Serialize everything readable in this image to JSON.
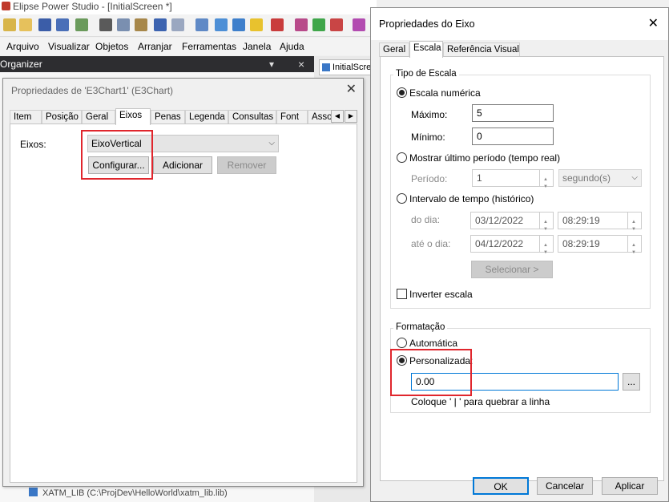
{
  "app": {
    "title": "Elipse Power Studio - [InitialScreen *]"
  },
  "menu": [
    "Arquivo",
    "Visualizar",
    "Objetos",
    "Arranjar",
    "Ferramentas",
    "Janela",
    "Ajuda"
  ],
  "organizer": {
    "title": "Organizer",
    "pin": "▾",
    "close": "×"
  },
  "document_tab": {
    "label": "InitialScreen"
  },
  "tree_bottom_item": "XATM_LIB (C:\\ProjDev\\HelloWorld\\xatm_lib.lib)",
  "chart_dialog": {
    "title": "Propriedades de 'E3Chart1' (E3Chart)",
    "tabs": [
      "Item",
      "Posição",
      "Geral",
      "Eixos",
      "Penas",
      "Legenda",
      "Consultas",
      "Font",
      "Asso"
    ],
    "active_tab": "Eixos",
    "axes_label": "Eixos:",
    "axes_selected": "EixoVertical",
    "configure_button": "Configurar...",
    "add_button": "Adicionar",
    "remove_button": "Remover"
  },
  "axis_dialog": {
    "title": "Propriedades do Eixo",
    "tabs": [
      "Geral",
      "Escala",
      "Referência Visual"
    ],
    "active_tab": "Escala",
    "scale_group_label": "Tipo de Escala",
    "numeric_scale": {
      "label": "Escala numérica",
      "max_label": "Máximo:",
      "max_value": "5",
      "min_label": "Mínimo:",
      "min_value": "0"
    },
    "last_period": {
      "label": "Mostrar último período (tempo real)",
      "period_label": "Período:",
      "period_value": "1",
      "unit": "segundo(s)"
    },
    "interval": {
      "label": "Intervalo de tempo (histórico)",
      "from_label": "do dia:",
      "from_date": "03/12/2022",
      "from_time": "08:29:19",
      "to_label": "até o dia:",
      "to_date": "04/12/2022",
      "to_time": "08:29:19",
      "select_button": "Selecionar >"
    },
    "invert_scale": "Inverter escala",
    "format_group_label": "Formatação",
    "format_auto": "Automática",
    "format_custom": "Personalizada:",
    "format_value": "0.00",
    "format_browse": "...",
    "format_hint": "Coloque ' | ' para quebrar a linha",
    "ok_button": "OK",
    "cancel_button": "Cancelar",
    "apply_button": "Aplicar"
  },
  "colors": {
    "highlight": "#e0262d",
    "accent": "#0078d7",
    "organizer_bar": "#2d2d30"
  }
}
